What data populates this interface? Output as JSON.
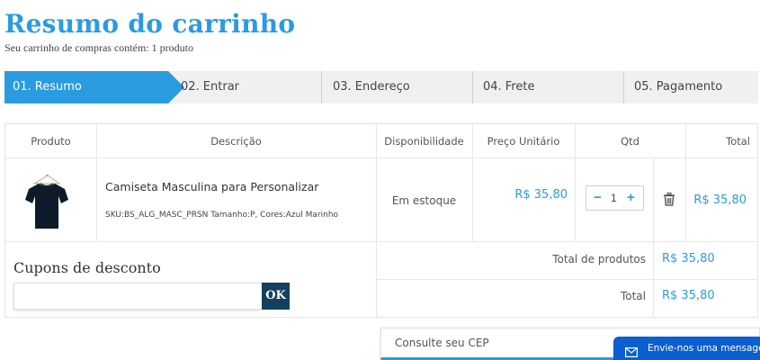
{
  "header": {
    "title": "Resumo do carrinho",
    "subtitle": "Seu carrinho de compras contém: 1 produto"
  },
  "steps": [
    {
      "label": "01. Resumo",
      "active": true
    },
    {
      "label": "02. Entrar"
    },
    {
      "label": "03. Endereço"
    },
    {
      "label": "04. Frete"
    },
    {
      "label": "05. Pagamento"
    }
  ],
  "table": {
    "headers": [
      "Produto",
      "Descrição",
      "Disponibilidade",
      "Preço Unitário",
      "Qtd",
      "Total"
    ],
    "rows": [
      {
        "image_icon": "tshirt-icon",
        "name": "Camiseta Masculina para Personalizar",
        "meta": "SKU:BS_ALG_MASC_PRSN Tamanho:P, Cores:Azul Marinho",
        "availability": "Em estoque",
        "unit_price": "R$ 35,80",
        "qty": "1",
        "total": "R$ 35,80"
      }
    ],
    "summary": {
      "products_label": "Total de produtos",
      "products_value": "R$ 35,80",
      "total_label": "Total",
      "total_value": "R$ 35,80"
    }
  },
  "coupon": {
    "title": "Cupons de desconto",
    "input_value": "",
    "button_label": "OK"
  },
  "cep": {
    "placeholder": "Consulte seu CEP"
  },
  "chat": {
    "label": "Envie-nos uma mensagem",
    "icon": "envelope-icon"
  },
  "colors": {
    "accent": "#2b9be0",
    "dark_button": "#13405e",
    "chat": "#0b5fcf"
  }
}
